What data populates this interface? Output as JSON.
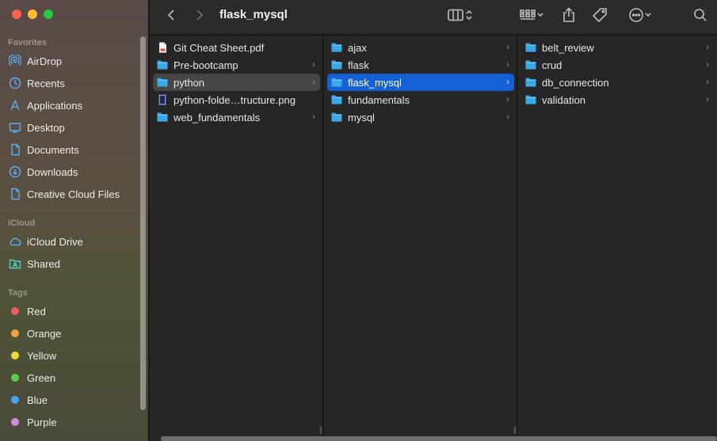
{
  "window": {
    "title": "flask_mysql"
  },
  "sidebar": {
    "favorites_label": "Favorites",
    "favorites": [
      {
        "label": "AirDrop",
        "icon": "airdrop-icon"
      },
      {
        "label": "Recents",
        "icon": "clock-icon"
      },
      {
        "label": "Applications",
        "icon": "applications-icon"
      },
      {
        "label": "Desktop",
        "icon": "desktop-icon"
      },
      {
        "label": "Documents",
        "icon": "document-icon"
      },
      {
        "label": "Downloads",
        "icon": "download-icon"
      },
      {
        "label": "Creative Cloud Files",
        "icon": "document-icon"
      }
    ],
    "icloud_label": "iCloud",
    "icloud": [
      {
        "label": "iCloud Drive",
        "icon": "cloud-icon"
      },
      {
        "label": "Shared",
        "icon": "shared-folder-icon"
      }
    ],
    "tags_label": "Tags",
    "tags": [
      {
        "label": "Red",
        "color": "#ec5f5f"
      },
      {
        "label": "Orange",
        "color": "#f2a33a"
      },
      {
        "label": "Yellow",
        "color": "#f5d531"
      },
      {
        "label": "Green",
        "color": "#5bcf4a"
      },
      {
        "label": "Blue",
        "color": "#4aa3ef"
      },
      {
        "label": "Purple",
        "color": "#d58ad8"
      }
    ]
  },
  "columns": [
    {
      "items": [
        {
          "name": "Git Cheat Sheet.pdf",
          "type": "file",
          "chevron": false
        },
        {
          "name": "Pre-bootcamp",
          "type": "folder",
          "chevron": true
        },
        {
          "name": "python",
          "type": "folder",
          "chevron": true,
          "selected": "gray"
        },
        {
          "name": "python-folde…tructure.png",
          "type": "image",
          "chevron": false
        },
        {
          "name": "web_fundamentals",
          "type": "folder",
          "chevron": true
        }
      ]
    },
    {
      "items": [
        {
          "name": "ajax",
          "type": "folder",
          "chevron": true
        },
        {
          "name": "flask",
          "type": "folder",
          "chevron": true
        },
        {
          "name": "flask_mysql",
          "type": "folder",
          "chevron": true,
          "selected": "blue"
        },
        {
          "name": "fundamentals",
          "type": "folder",
          "chevron": true
        },
        {
          "name": "mysql",
          "type": "folder",
          "chevron": true
        }
      ]
    },
    {
      "items": [
        {
          "name": "belt_review",
          "type": "folder",
          "chevron": true
        },
        {
          "name": "crud",
          "type": "folder",
          "chevron": true
        },
        {
          "name": "db_connection",
          "type": "folder",
          "chevron": true
        },
        {
          "name": "validation",
          "type": "folder",
          "chevron": true
        }
      ]
    }
  ],
  "colors": {
    "accent": "#1560d4",
    "folder": "#3aa9e6"
  }
}
